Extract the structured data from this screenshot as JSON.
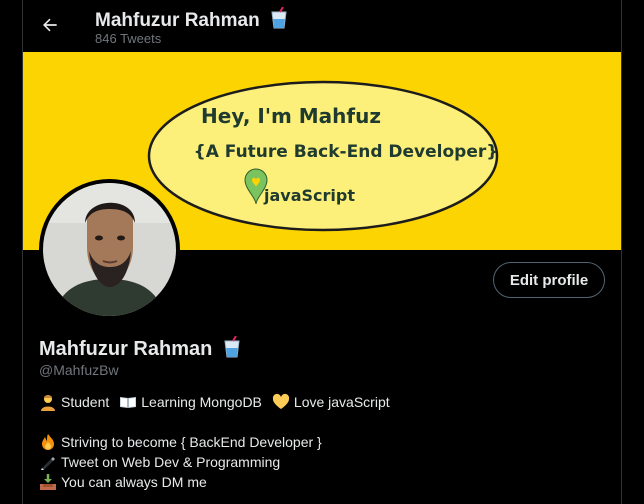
{
  "header": {
    "name": "Mahfuzur Rahman",
    "tweet_count": "846 Tweets",
    "back_icon": "arrow-left-icon"
  },
  "banner": {
    "line1": "Hey, I'm Mahfuz",
    "line2": "{A Future Back-End Developer}",
    "line3": "javaScript",
    "background": "#fcd401",
    "ellipse_fill": "#fdf07a"
  },
  "profile": {
    "name": "Mahfuzur Rahman",
    "handle": "@MahfuzBw",
    "edit_label": "Edit profile",
    "name_emoji": "juice-cup-icon"
  },
  "bio": {
    "line1": [
      {
        "icon": "student-icon",
        "text": "Student"
      },
      {
        "icon": "open-book-icon",
        "text": "Learning MongoDB"
      },
      {
        "icon": "yellow-heart-icon",
        "text": "Love javaScript"
      }
    ],
    "line2": {
      "icon": "fire-icon",
      "text": "Striving to become { BackEnd Developer }"
    },
    "line3": {
      "icon": "pen-icon",
      "text": "Tweet on Web Dev & Programming"
    },
    "line4": {
      "icon": "inbox-tray-icon",
      "text": "You can always DM me"
    }
  },
  "colors": {
    "text": "#e7e9ea",
    "muted": "#71767b",
    "border": "#2f3336",
    "button_border": "#536471"
  }
}
